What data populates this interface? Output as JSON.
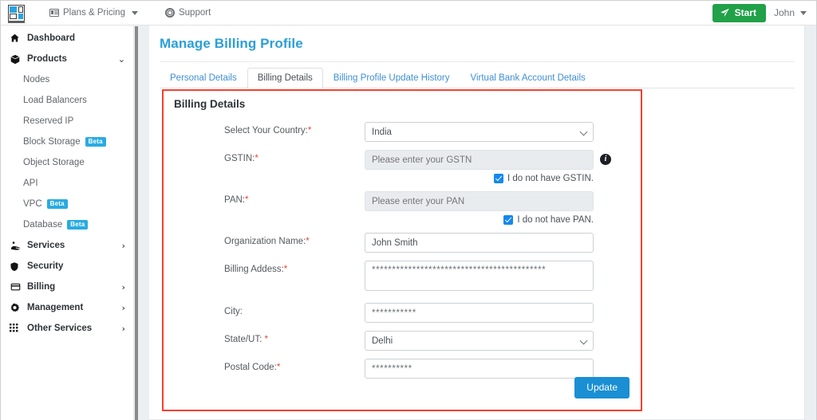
{
  "topbar": {
    "logo_name": "logo",
    "plans_label": "Plans & Pricing",
    "support_label": "Support",
    "start_label": "Start",
    "user_label": "John"
  },
  "sidebar": {
    "items": [
      {
        "label": "Dashboard",
        "icon": "home-icon",
        "chevron": ""
      },
      {
        "label": "Products",
        "icon": "box-icon",
        "chevron": "⌄"
      }
    ],
    "products_children": [
      {
        "label": "Nodes",
        "badge": ""
      },
      {
        "label": "Load Balancers",
        "badge": ""
      },
      {
        "label": "Reserved IP",
        "badge": ""
      },
      {
        "label": "Block Storage",
        "badge": "Beta"
      },
      {
        "label": "Object Storage",
        "badge": ""
      },
      {
        "label": "API",
        "badge": ""
      },
      {
        "label": "VPC",
        "badge": "Beta"
      },
      {
        "label": "Database",
        "badge": "Beta"
      }
    ],
    "bottom_items": [
      {
        "label": "Services",
        "icon": "services-icon",
        "chevron": "›"
      },
      {
        "label": "Security",
        "icon": "shield-icon",
        "chevron": ""
      },
      {
        "label": "Billing",
        "icon": "credit-card-icon",
        "chevron": "›"
      },
      {
        "label": "Management",
        "icon": "gear-icon",
        "chevron": "›"
      },
      {
        "label": "Other Services",
        "icon": "grid-icon",
        "chevron": "›"
      }
    ]
  },
  "main": {
    "page_title": "Manage Billing Profile",
    "tabs": [
      {
        "label": "Personal Details",
        "active": false
      },
      {
        "label": "Billing Details",
        "active": true
      },
      {
        "label": "Billing Profile Update History",
        "active": false
      },
      {
        "label": "Virtual Bank Account Details",
        "active": false
      }
    ],
    "section_title": "Billing Details",
    "fields": {
      "country": {
        "label": "Select Your Country:",
        "required": true,
        "value": "India",
        "options": [
          "India"
        ]
      },
      "gstin": {
        "label": "GSTIN:",
        "required": true,
        "value": "",
        "placeholder": "Please enter your GSTN",
        "disabled": true,
        "info_tooltip_icon": "info-icon",
        "checkbox_label": "I do not have GSTIN.",
        "checkbox_checked": true
      },
      "pan": {
        "label": "PAN:",
        "required": true,
        "value": "",
        "placeholder": "Please enter your PAN",
        "disabled": true,
        "checkbox_label": "I do not have PAN.",
        "checkbox_checked": true
      },
      "organization": {
        "label": "Organization Name:",
        "required": true,
        "value": "John Smith",
        "placeholder": ""
      },
      "billing_address": {
        "label": "Billing Addess:",
        "required": true,
        "value": "*******************************************",
        "placeholder": ""
      },
      "city": {
        "label": "City:",
        "required": false,
        "value": "***********",
        "placeholder": ""
      },
      "state": {
        "label": "State/UT: ",
        "required": true,
        "value": "Delhi",
        "options": [
          "Delhi"
        ]
      },
      "postal_code": {
        "label": "Postal Code:",
        "required": true,
        "value": "**********",
        "placeholder": ""
      }
    },
    "update_label": "Update"
  },
  "colors": {
    "accent_blue": "#2a9fd8",
    "link_blue": "#3f8fd4",
    "highlight_red": "#f4402f",
    "start_green": "#21a148",
    "beta_badge": "#29abe2",
    "checkbox_blue": "#1488ef",
    "update_button": "#1a8fd3"
  }
}
